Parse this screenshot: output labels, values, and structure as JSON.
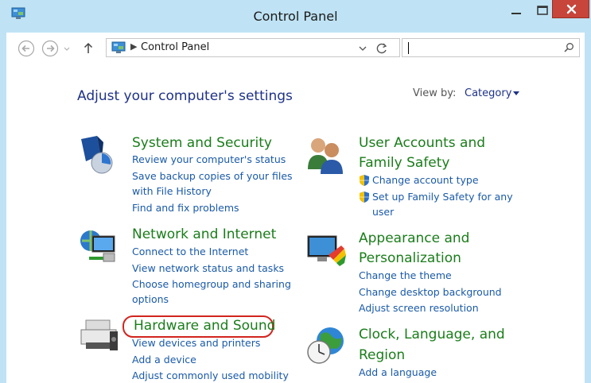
{
  "window": {
    "title": "Control Panel"
  },
  "addressbar": {
    "path": "Control Panel",
    "search_placeholder": ""
  },
  "main": {
    "heading": "Adjust your computer's settings",
    "view_by_label": "View by:",
    "view_by_value": "Category",
    "categories": [
      {
        "title": "System and Security",
        "icon": "system-security-icon",
        "links": [
          "Review your computer's status",
          "Save backup copies of your files",
          "with File History",
          "Find and fix problems"
        ]
      },
      {
        "title": "Network and Internet",
        "icon": "network-internet-icon",
        "links": [
          "Connect to the Internet",
          "View network status and tasks",
          "Choose homegroup and sharing",
          "options"
        ]
      },
      {
        "title": "Hardware and Sound",
        "icon": "hardware-sound-icon",
        "links": [
          "View devices and printers",
          "Add a device",
          "Adjust commonly used mobility"
        ]
      },
      {
        "title_line1": "User Accounts and",
        "title_line2": "Family Safety",
        "icon": "user-accounts-icon",
        "links": [
          "Change account type",
          "Set up Family Safety for any",
          "user"
        ]
      },
      {
        "title_line1": "Appearance and",
        "title_line2": "Personalization",
        "icon": "appearance-icon",
        "links": [
          "Change the theme",
          "Change desktop background",
          "Adjust screen resolution"
        ]
      },
      {
        "title_line1": "Clock, Language, and",
        "title_line2": "Region",
        "icon": "clock-globe-icon",
        "links": [
          "Add a language"
        ]
      }
    ]
  },
  "colors": {
    "title_bg": "#bfe3f4",
    "category_title": "#1a7d1a",
    "link": "#1a5aa8",
    "heading": "#1e3287",
    "highlight": "#d1251e",
    "close_button": "#c7453a"
  }
}
